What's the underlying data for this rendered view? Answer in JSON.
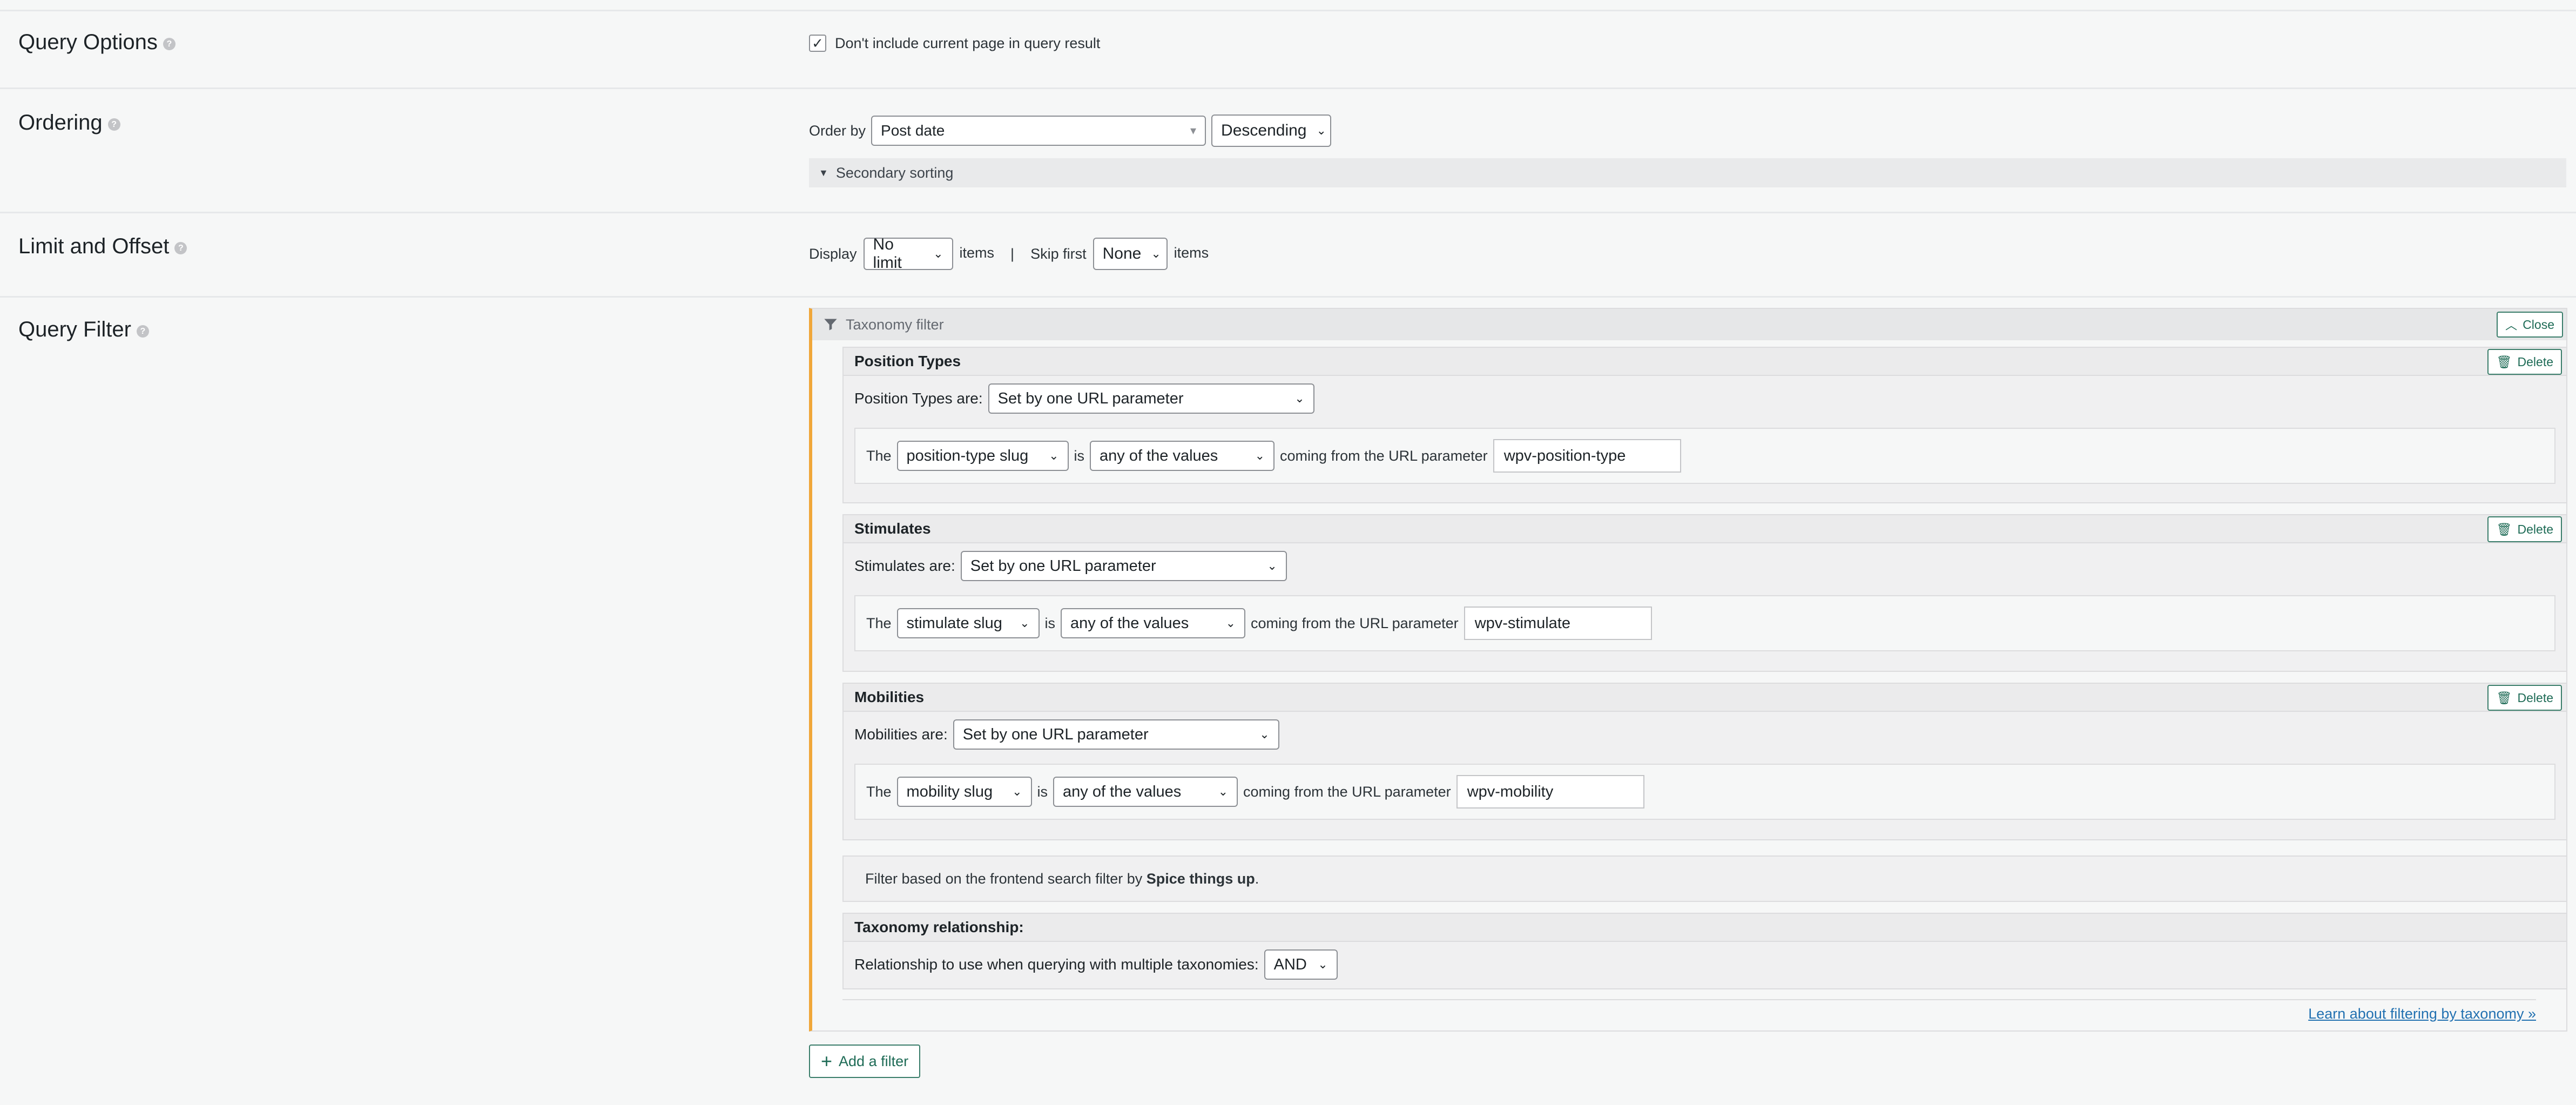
{
  "sections": {
    "query_options": "Query Options",
    "ordering": "Ordering",
    "limit_offset": "Limit and Offset",
    "query_filter": "Query Filter"
  },
  "query_options": {
    "checkbox_checked": true,
    "checkbox_label": "Don't include current page in query result"
  },
  "ordering": {
    "order_by_label": "Order by",
    "order_by_value": "Post date",
    "direction_value": "Descending",
    "secondary_sorting": "Secondary sorting"
  },
  "limit": {
    "display_label": "Display",
    "display_value": "No limit",
    "items1": "items",
    "separator": "|",
    "skip_label": "Skip first",
    "skip_value": "None",
    "items2": "items"
  },
  "filter": {
    "head_label": "Taxonomy filter",
    "close_label": "Close",
    "delete_label": "Delete",
    "taxonomies": [
      {
        "title": "Position Types",
        "are_label": "Position Types are:",
        "mode": "Set by one URL parameter",
        "the": "The",
        "field": "position-type slug",
        "is": "is",
        "op": "any of the values",
        "coming": "coming from the URL parameter",
        "param": "wpv-position-type"
      },
      {
        "title": "Stimulates",
        "are_label": "Stimulates are:",
        "mode": "Set by one URL parameter",
        "the": "The",
        "field": "stimulate slug",
        "is": "is",
        "op": "any of the values",
        "coming": "coming from the URL parameter",
        "param": "wpv-stimulate"
      },
      {
        "title": "Mobilities",
        "are_label": "Mobilities are:",
        "mode": "Set by one URL parameter",
        "the": "The",
        "field": "mobility slug",
        "is": "is",
        "op": "any of the values",
        "coming": "coming from the URL parameter",
        "param": "wpv-mobility"
      }
    ],
    "note_prefix": "Filter based on the frontend search filter by ",
    "note_bold": "Spice things up",
    "note_suffix": ".",
    "relationship_title": "Taxonomy relationship:",
    "relationship_label": "Relationship to use when querying with multiple taxonomies:",
    "relationship_value": "AND",
    "learn_link": "Learn about filtering by taxonomy »",
    "add_filter": "Add a filter"
  },
  "icons": {
    "help": "help-icon",
    "filter": "funnel-icon",
    "close": "chevron-up-icon",
    "delete": "trash-icon",
    "add": "plus-icon"
  },
  "colors": {
    "accent_orange": "#f0a73a",
    "button_green": "#1e6b56",
    "link_blue": "#2271b1"
  }
}
